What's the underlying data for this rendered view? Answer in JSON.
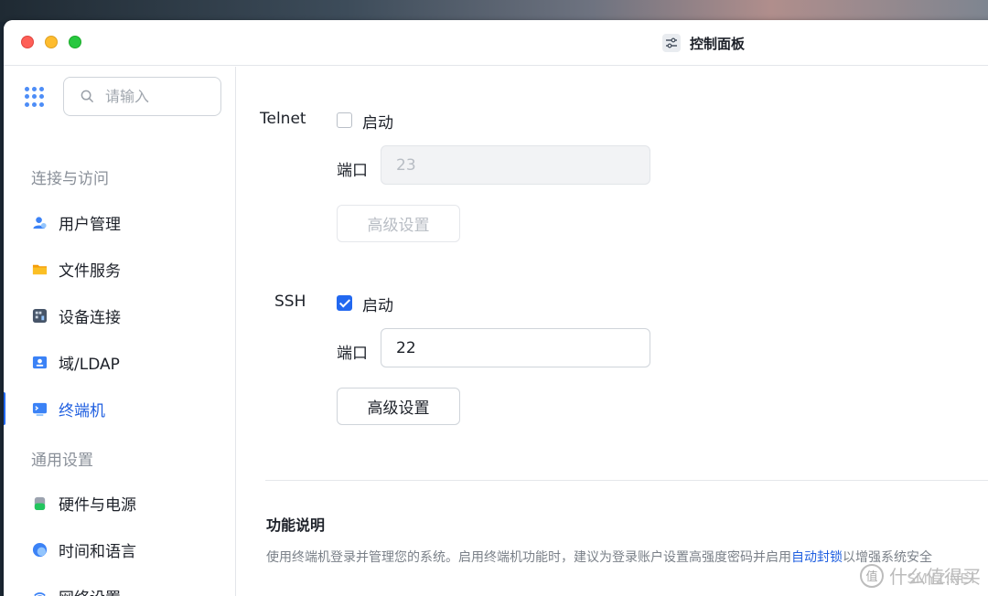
{
  "window": {
    "title": "控制面板"
  },
  "search": {
    "placeholder": "请输入"
  },
  "sidebar": {
    "sections": [
      {
        "label": "连接与访问"
      },
      {
        "label": "通用设置"
      }
    ],
    "items": [
      {
        "label": "用户管理",
        "icon": "users-icon",
        "color": "#3b82f6"
      },
      {
        "label": "文件服务",
        "icon": "folder-icon",
        "color": "#f59e0b"
      },
      {
        "label": "设备连接",
        "icon": "device-icon",
        "color": "#475569"
      },
      {
        "label": "域/LDAP",
        "icon": "id-card-icon",
        "color": "#3b82f6"
      },
      {
        "label": "终端机",
        "icon": "terminal-icon",
        "color": "#3b82f6",
        "active": true
      },
      {
        "label": "硬件与电源",
        "icon": "battery-icon",
        "color": "#22c55e"
      },
      {
        "label": "时间和语言",
        "icon": "clock-icon",
        "color": "#3b82f6"
      },
      {
        "label": "网络设置",
        "icon": "network-icon",
        "color": "#3b82f6"
      }
    ]
  },
  "telnet": {
    "label": "Telnet",
    "enable_label": "启动",
    "enabled": false,
    "port_label": "端口",
    "port_value": "23",
    "advanced_label": "高级设置"
  },
  "ssh": {
    "label": "SSH",
    "enable_label": "启动",
    "enabled": true,
    "port_label": "端口",
    "port_value": "22",
    "advanced_label": "高级设置"
  },
  "description": {
    "title": "功能说明",
    "text_before": "使用终端机登录并管理您的系统。启用终端机功能时，建议为登录账户设置高强度密码并启用",
    "link": "自动封锁",
    "text_after": "以增强系统安全"
  },
  "watermark": {
    "text": "什么值得买",
    "sub": "SMYZ.NET",
    "glyph": "值"
  },
  "colors": {
    "accent": "#2268f0",
    "link": "#1f5fe0"
  }
}
